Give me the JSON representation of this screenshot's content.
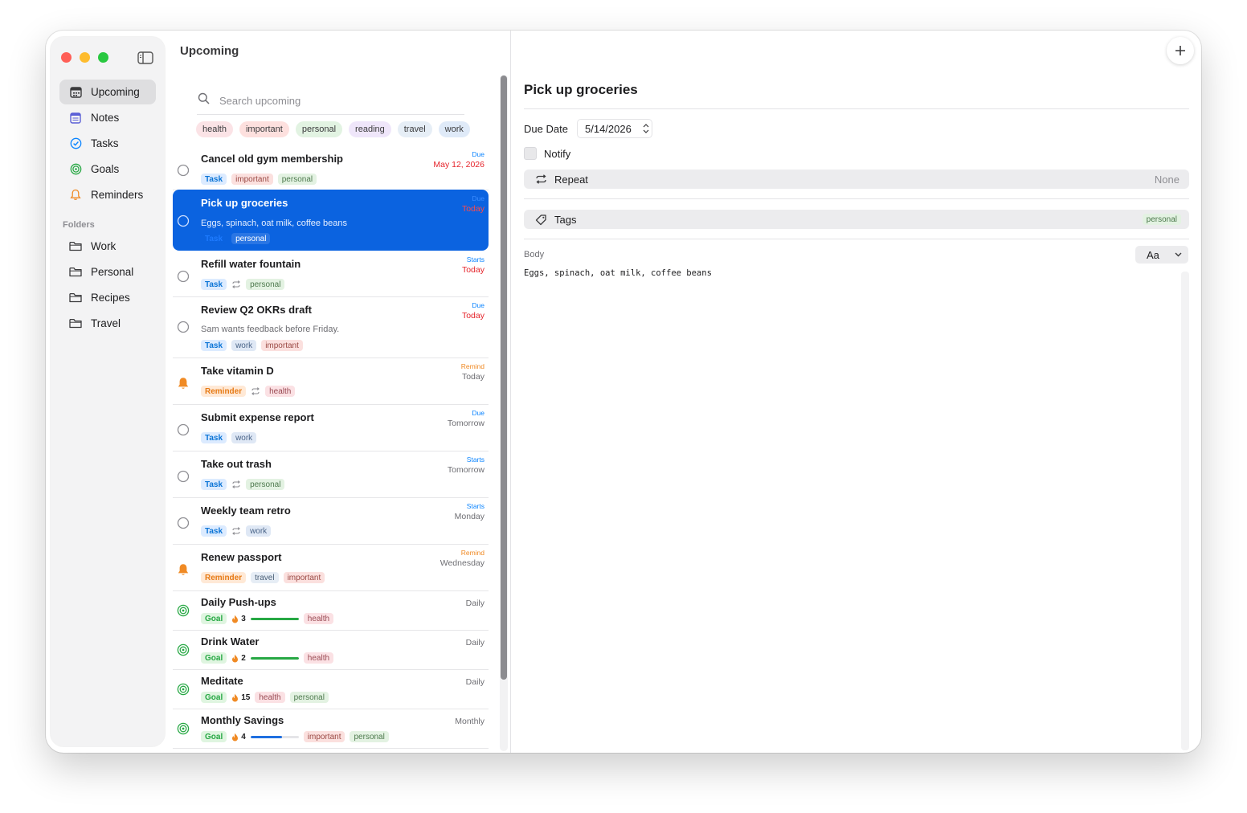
{
  "app": {
    "list_title": "Upcoming"
  },
  "sidebar": {
    "items": [
      {
        "label": "Upcoming",
        "icon": "calendar-icon"
      },
      {
        "label": "Notes",
        "icon": "notes-icon"
      },
      {
        "label": "Tasks",
        "icon": "checkmark-circle-icon"
      },
      {
        "label": "Goals",
        "icon": "target-icon"
      },
      {
        "label": "Reminders",
        "icon": "bell-icon"
      }
    ],
    "folders_label": "Folders",
    "folders": [
      {
        "label": "Work"
      },
      {
        "label": "Personal"
      },
      {
        "label": "Recipes"
      },
      {
        "label": "Travel"
      }
    ]
  },
  "search": {
    "placeholder": "Search upcoming"
  },
  "filters": [
    "health",
    "important",
    "personal",
    "reading",
    "travel",
    "work"
  ],
  "rows": [
    {
      "title": "Cancel old gym membership",
      "type": "Task",
      "tags": [
        "important",
        "personal"
      ],
      "label": "Due",
      "date": "May 12, 2026"
    },
    {
      "title": "Pick up groceries",
      "subtitle": "Eggs, spinach, oat milk, coffee beans",
      "type": "Task",
      "tags": [
        "personal"
      ],
      "label": "Due",
      "date": "Today"
    },
    {
      "title": "Refill water fountain",
      "type": "Task",
      "tags": [
        "personal"
      ],
      "label": "Starts",
      "date": "Today"
    },
    {
      "title": "Review Q2 OKRs draft",
      "subtitle": "Sam wants feedback before Friday.",
      "type": "Task",
      "tags": [
        "work",
        "important"
      ],
      "label": "Due",
      "date": "Today"
    },
    {
      "title": "Take vitamin D",
      "type": "Reminder",
      "tags": [
        "health"
      ],
      "label": "Remind",
      "date": "Today"
    },
    {
      "title": "Submit expense report",
      "type": "Task",
      "tags": [
        "work"
      ],
      "label": "Due",
      "date": "Tomorrow"
    },
    {
      "title": "Take out trash",
      "type": "Task",
      "tags": [
        "personal"
      ],
      "label": "Starts",
      "date": "Tomorrow"
    },
    {
      "title": "Weekly team retro",
      "type": "Task",
      "tags": [
        "work"
      ],
      "label": "Starts",
      "date": "Monday"
    },
    {
      "title": "Renew passport",
      "type": "Reminder",
      "tags": [
        "travel",
        "important"
      ],
      "label": "Remind",
      "date": "Wednesday"
    },
    {
      "title": "Daily Push-ups",
      "type": "Goal",
      "streak": "3",
      "progress": 1.0,
      "tags": [
        "health"
      ],
      "date": "Daily"
    },
    {
      "title": "Drink Water",
      "type": "Goal",
      "streak": "2",
      "progress": 1.0,
      "tags": [
        "health"
      ],
      "date": "Daily"
    },
    {
      "title": "Meditate",
      "type": "Goal",
      "streak": "15",
      "tags": [
        "health",
        "personal"
      ],
      "date": "Daily"
    },
    {
      "title": "Monthly Savings",
      "type": "Goal",
      "streak": "4",
      "progress": 0.65,
      "tags": [
        "important",
        "personal"
      ],
      "date": "Monthly"
    }
  ],
  "detail": {
    "title": "Pick up groceries",
    "due_label": "Due Date",
    "due_value": "5/14/2026",
    "notify_label": "Notify",
    "repeat_label": "Repeat",
    "repeat_value": "None",
    "tags_label": "Tags",
    "tags_value": "personal",
    "body_label": "Body",
    "font_button": "Aa",
    "body_text": "Eggs, spinach, oat milk, coffee beans"
  },
  "colors": {
    "selection_blue": "#0b63e0",
    "accent_blue": "#0a84ff",
    "due_red": "#e5242b",
    "remind_orange": "#f08a24",
    "goal_green": "#27a844",
    "savings_blue": "#1f6fe0"
  }
}
